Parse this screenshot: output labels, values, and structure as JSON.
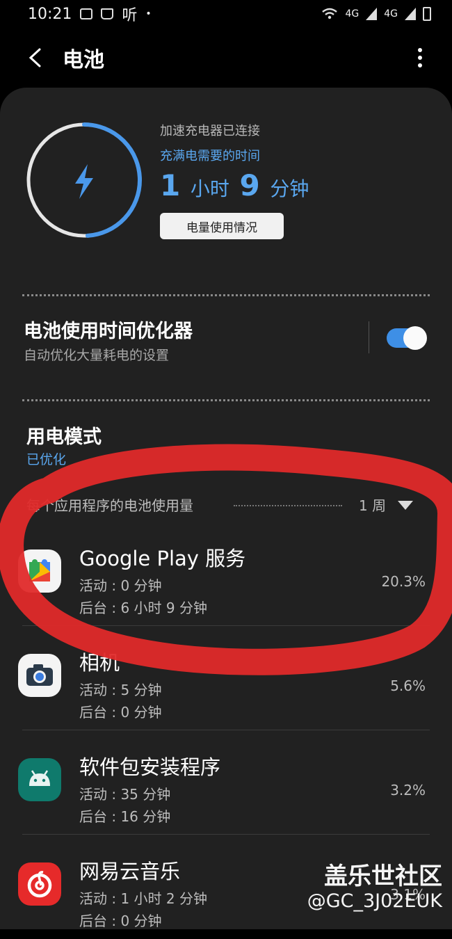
{
  "statusbar": {
    "time": "10:21",
    "extra": "听",
    "net1": "4G",
    "net2": "4G"
  },
  "header": {
    "title": "电池"
  },
  "charging": {
    "status": "加速充电器已连接",
    "label": "充满电需要的时间",
    "hours": "1",
    "hours_unit": "小时",
    "minutes": "9",
    "minutes_unit": "分钟",
    "usage_button": "电量使用情况",
    "ring_fill_fraction": 0.49
  },
  "optimizer": {
    "title": "电池使用时间优化器",
    "subtitle": "自动优化大量耗电的设置",
    "enabled": true
  },
  "power_mode": {
    "title": "用电模式",
    "value": "已优化"
  },
  "app_usage": {
    "heading": "每个应用程序的电池使用量",
    "period": "1 周",
    "apps": [
      {
        "name": "Google Play 服务",
        "active": "活动 : 0 分钟",
        "background": "后台 : 6 小时 9 分钟",
        "percent": "20.3%",
        "icon": "google-play-services-icon"
      },
      {
        "name": "相机",
        "active": "活动 : 5 分钟",
        "background": "后台 : 0 分钟",
        "percent": "5.6%",
        "icon": "camera-app-icon"
      },
      {
        "name": "软件包安装程序",
        "active": "活动 : 35 分钟",
        "background": "后台 : 16 分钟",
        "percent": "3.2%",
        "icon": "android-package-installer-icon"
      },
      {
        "name": "网易云音乐",
        "active": "活动 : 1 小时 2 分钟",
        "background": "后台 : 0 分钟",
        "percent": "3.1%",
        "icon": "netease-music-icon"
      }
    ]
  },
  "watermark": {
    "line1": "盖乐世社区",
    "line2": "@GC_3J02EUK"
  },
  "colors": {
    "accent": "#5aa7ef",
    "panel": "#212121",
    "annotation": "#e02a2a"
  }
}
